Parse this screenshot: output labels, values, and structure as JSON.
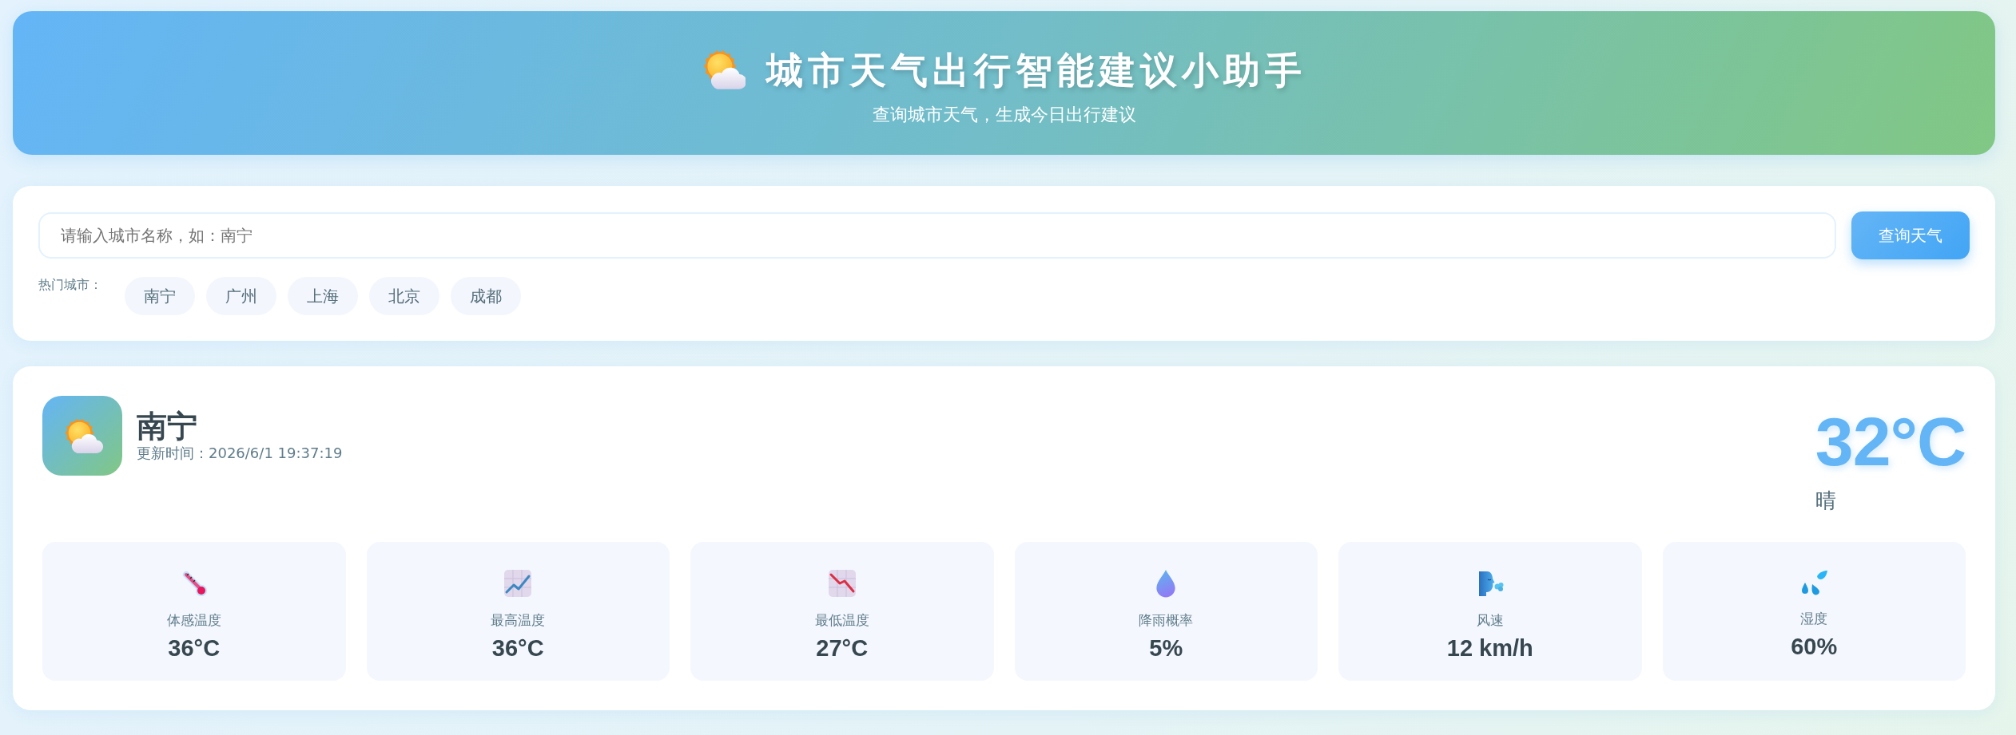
{
  "header": {
    "title": "城市天气出行智能建议小助手",
    "subtitle": "查询城市天气，生成今日出行建议"
  },
  "search": {
    "placeholder": "请输入城市名称，如：南宁",
    "button": "查询天气",
    "hot_label": "热门城市：",
    "hot_cities": [
      "南宁",
      "广州",
      "上海",
      "北京",
      "成都"
    ]
  },
  "weather": {
    "city": "南宁",
    "updated": "更新时间：2026/6/1 19:37:19",
    "temperature": "32°C",
    "condition": "晴",
    "stats": [
      {
        "kind": "thermometer",
        "label": "体感温度",
        "value": "36°C"
      },
      {
        "kind": "chart_up",
        "label": "最高温度",
        "value": "36°C"
      },
      {
        "kind": "chart_down",
        "label": "最低温度",
        "value": "27°C"
      },
      {
        "kind": "droplet",
        "label": "降雨概率",
        "value": "5%"
      },
      {
        "kind": "wind",
        "label": "风速",
        "value": "12 km/h"
      },
      {
        "kind": "droplets",
        "label": "湿度",
        "value": "60%"
      }
    ]
  }
}
